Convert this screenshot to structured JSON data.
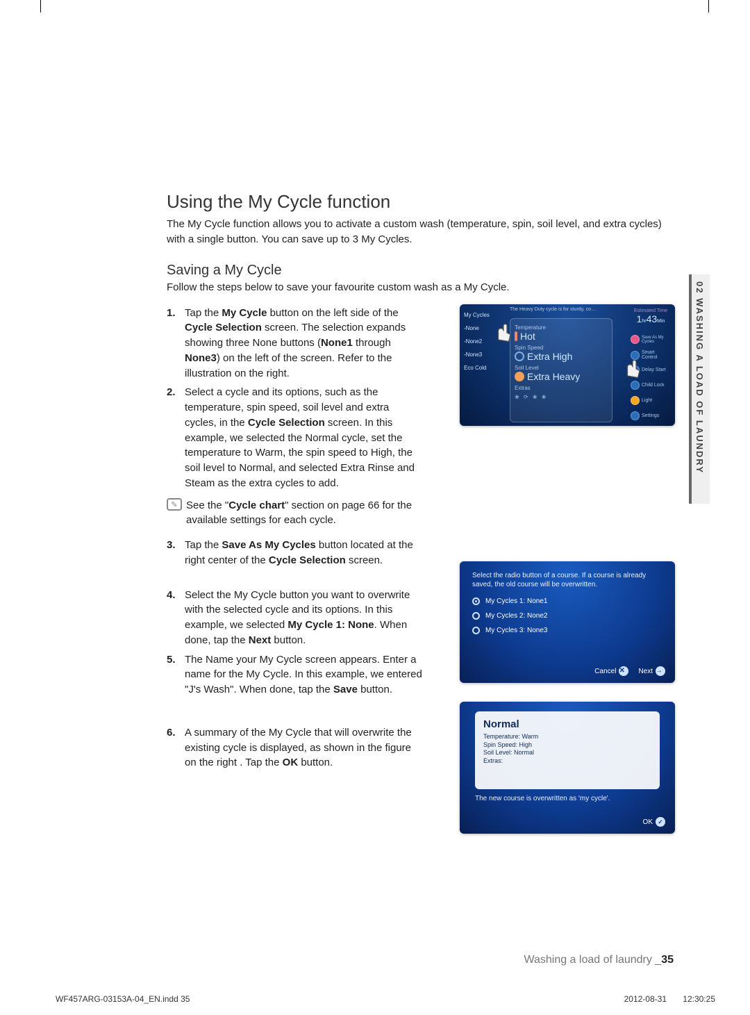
{
  "side_tab": "02 WASHING A LOAD OF LAUNDRY",
  "h2": "Using the My Cycle function",
  "intro": "The My Cycle function allows you to activate a custom wash (temperature, spin, soil level, and extra cycles) with a single button. You can save up to 3 My Cycles.",
  "h3": "Saving a My Cycle",
  "follow": "Follow the steps below to save your favourite custom wash as a My Cycle.",
  "steps": {
    "s1": "button on the left side of the ",
    "s1_pre": "Tap the ",
    "s1_b1": "My Cycle",
    "s1_mid": " screen. The selection expands showing three None buttons (",
    "s1_cs": "Cycle Selection",
    "s1_n1": "None1",
    "s1_thru": " through ",
    "s1_n3": "None3",
    "s1_end": ") on the left of the screen. Refer to the illustration on the right.",
    "s2": "Select a cycle and its options, such as the temperature, spin speed, soil level and extra cycles, in the ",
    "s2_cs": "Cycle Selection",
    "s2_end": " screen. In this example, we selected the Normal cycle, set the temperature to Warm, the spin speed to High, the soil level to Normal, and selected Extra Rinse and Steam as the extra cycles to add.",
    "note": "See the \"",
    "note_b": "Cycle chart",
    "note_end": "\" section on page 66 for the available settings for each cycle.",
    "s3_pre": "Tap the ",
    "s3_b": "Save As My Cycles",
    "s3_mid": " button located at the right center of the ",
    "s3_cs": "Cycle Selection",
    "s3_end": " screen.",
    "s4": "Select the My Cycle button you want to overwrite with the selected cycle and its options. In this example, we selected ",
    "s4_b": "My Cycle 1: None",
    "s4_mid": ". When done, tap the ",
    "s4_next": "Next",
    "s4_end": " button.",
    "s5": "The Name your My Cycle screen appears. Enter a name for the My Cycle. In this example, we entered \"J's Wash\". When done, tap the ",
    "s5_b": "Save",
    "s5_end": " button.",
    "s6": "A summary of the My Cycle that will overwrite the existing cycle is displayed, as shown in the figure on the right . Tap the ",
    "s6_b": "OK",
    "s6_end": " button."
  },
  "fig1": {
    "sidebar": {
      "mycycles": "My Cycles",
      "n1": "-None",
      "n2": "-None2",
      "n3": "-None3",
      "eco": "Eco Cold"
    },
    "banner": "The Heavy Duty cycle is for sturdy, co…",
    "temp_lbl": "Temperature",
    "temp_val": "Hot",
    "spin_lbl": "Spin Speed",
    "spin_val": "Extra High",
    "soil_lbl": "Soil Level",
    "soil_val": "Extra Heavy",
    "extras_lbl": "Extras",
    "est_lbl": "Estimated Time",
    "est_hr": "1",
    "est_hr_u": "hr",
    "est_min": "43",
    "est_min_u": "Min",
    "r1": "Save As My Cycles",
    "r2": "Smart Control",
    "r3": "Delay Start",
    "r4": "Child Lock",
    "r5": "Light",
    "r6": "Settings"
  },
  "fig2": {
    "hdr": "Select the radio button of a course. If a course is already saved, the old course will be overwritten.",
    "o1": "My Cycles 1: None1",
    "o2": "My Cycles 2: None2",
    "o3": "My Cycles 3: None3",
    "cancel": "Cancel",
    "next": "Next"
  },
  "fig3": {
    "name": "Normal",
    "l1": "Temperature: Warm",
    "l2": "Spin Speed: High",
    "l3": "Soil Level: Normal",
    "l4": "Extras:",
    "msg": "The new course is overwritten as 'my cycle'.",
    "ok": "OK"
  },
  "footer": {
    "label": "Washing a load of laundry _",
    "pg": "35"
  },
  "imprint": {
    "file": "WF457ARG-03153A-04_EN.indd   35",
    "date": "2012-08-31",
    "time": "12:30:25"
  },
  "nums": {
    "n1": "1.",
    "n2": "2.",
    "n3": "3.",
    "n4": "4.",
    "n5": "5.",
    "n6": "6."
  },
  "icons": {
    "note": "✎",
    "x": "✕",
    "arrow": "→",
    "check": "✓"
  },
  "extras_glyphs": "❀  ⟳  ❀  ❀"
}
